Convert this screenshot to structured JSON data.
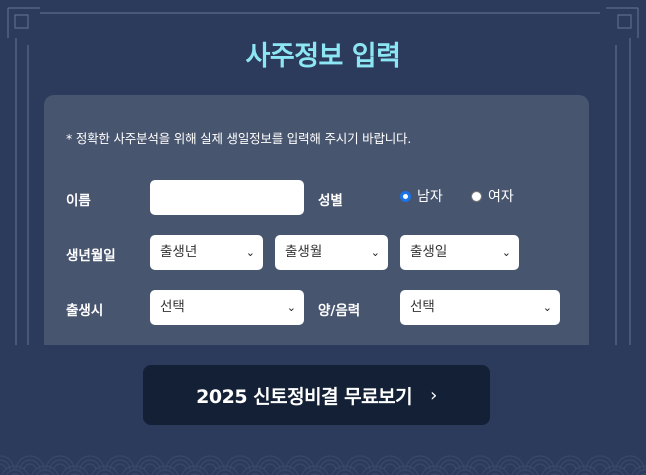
{
  "header": {
    "title": "사주정보 입력"
  },
  "form": {
    "notice": "* 정확한 사주분석을 위해 실제 생일정보를 입력해 주시기 바랍니다.",
    "name_label": "이름",
    "name_value": "",
    "gender_label": "성별",
    "gender_options": [
      {
        "label": "남자",
        "selected": true
      },
      {
        "label": "여자",
        "selected": false
      }
    ],
    "birthdate_label": "생년월일",
    "birth_year": "출생년",
    "birth_month": "출생월",
    "birth_day": "출생일",
    "birthtime_label": "출생시",
    "birthtime_value": "선택",
    "calendar_label": "양/음력",
    "calendar_value": "선택"
  },
  "cta": {
    "label": "2025 신토정비결 무료보기",
    "arrow_icon": "chevron-right-icon"
  },
  "colors": {
    "background": "#2c3a5c",
    "panel": "#48556f",
    "title": "#8de6f3",
    "button": "#132035",
    "radio_accent": "#1a73e8"
  }
}
